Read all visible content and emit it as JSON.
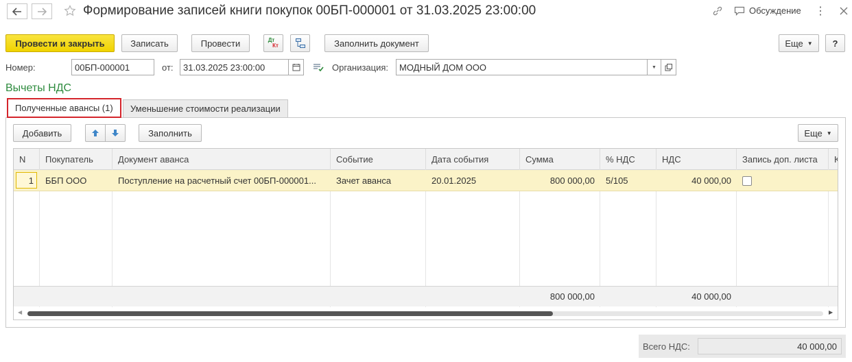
{
  "window": {
    "title": "Формирование записей книги покупок 00БП-000001 от 31.03.2025 23:00:00",
    "discussion_label": "Обсуждение"
  },
  "toolbar": {
    "post_and_close": "Провести и закрыть",
    "save": "Записать",
    "post": "Провести",
    "dtkt_top": "Дт",
    "dtkt_bottom": "Кт",
    "fill_document": "Заполнить документ",
    "more": "Еще",
    "help": "?"
  },
  "form": {
    "number_label": "Номер:",
    "number_value": "00БП-000001",
    "date_label": "от:",
    "date_value": "31.03.2025 23:00:00",
    "org_label": "Организация:",
    "org_value": "МОДНЫЙ ДОМ ООО"
  },
  "section_title": "Вычеты НДС",
  "tabs": [
    {
      "label": "Полученные авансы (1)"
    },
    {
      "label": "Уменьшение стоимости реализации"
    }
  ],
  "table_toolbar": {
    "add": "Добавить",
    "fill": "Заполнить",
    "more": "Еще"
  },
  "table": {
    "columns": [
      "N",
      "Покупатель",
      "Документ аванса",
      "Событие",
      "Дата события",
      "Сумма",
      "% НДС",
      "НДС",
      "Запись доп. листа",
      "К"
    ],
    "rows": [
      {
        "n": "1",
        "buyer": "ББП ООО",
        "document": "Поступление на расчетный счет 00БП-000001...",
        "event": "Зачет аванса",
        "event_date": "20.01.2025",
        "amount": "800 000,00",
        "vat_rate": "5/105",
        "vat": "40 000,00",
        "extra_sheet": false
      }
    ],
    "totals": {
      "amount": "800 000,00",
      "vat": "40 000,00"
    }
  },
  "footer": {
    "total_vat_label": "Всего НДС:",
    "total_vat_value": "40 000,00"
  },
  "colors": {
    "primary_button": "#f5d800",
    "selected_row": "#fbf3c8",
    "section_title": "#2e8b3e",
    "tab_highlight": "#d4242b"
  }
}
